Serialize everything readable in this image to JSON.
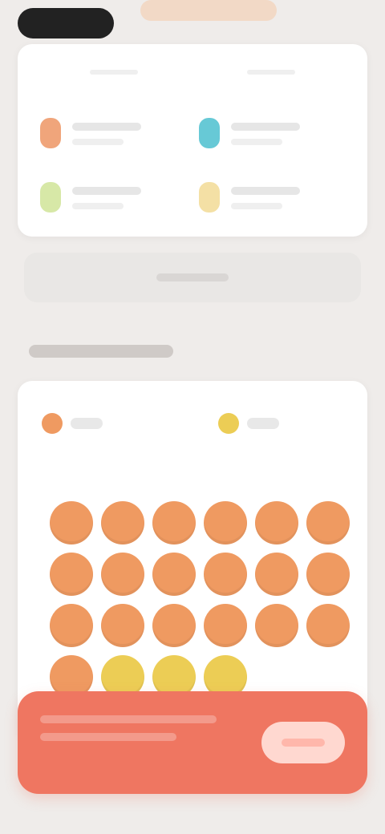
{
  "colors": {
    "background": "#efecea",
    "accent_orange": "#ef9a61",
    "accent_yellow": "#eccd55",
    "cta": "#ef7661"
  },
  "icons": {
    "metric1": "orange-pill-icon",
    "metric2": "teal-drop-icon",
    "metric3": "green-leaf-icon",
    "metric4": "yellow-pill-icon",
    "legend1": "orange-circle-icon",
    "legend2": "yellow-circle-icon"
  },
  "grid": {
    "orange_count": 19,
    "yellow_count": 3
  }
}
